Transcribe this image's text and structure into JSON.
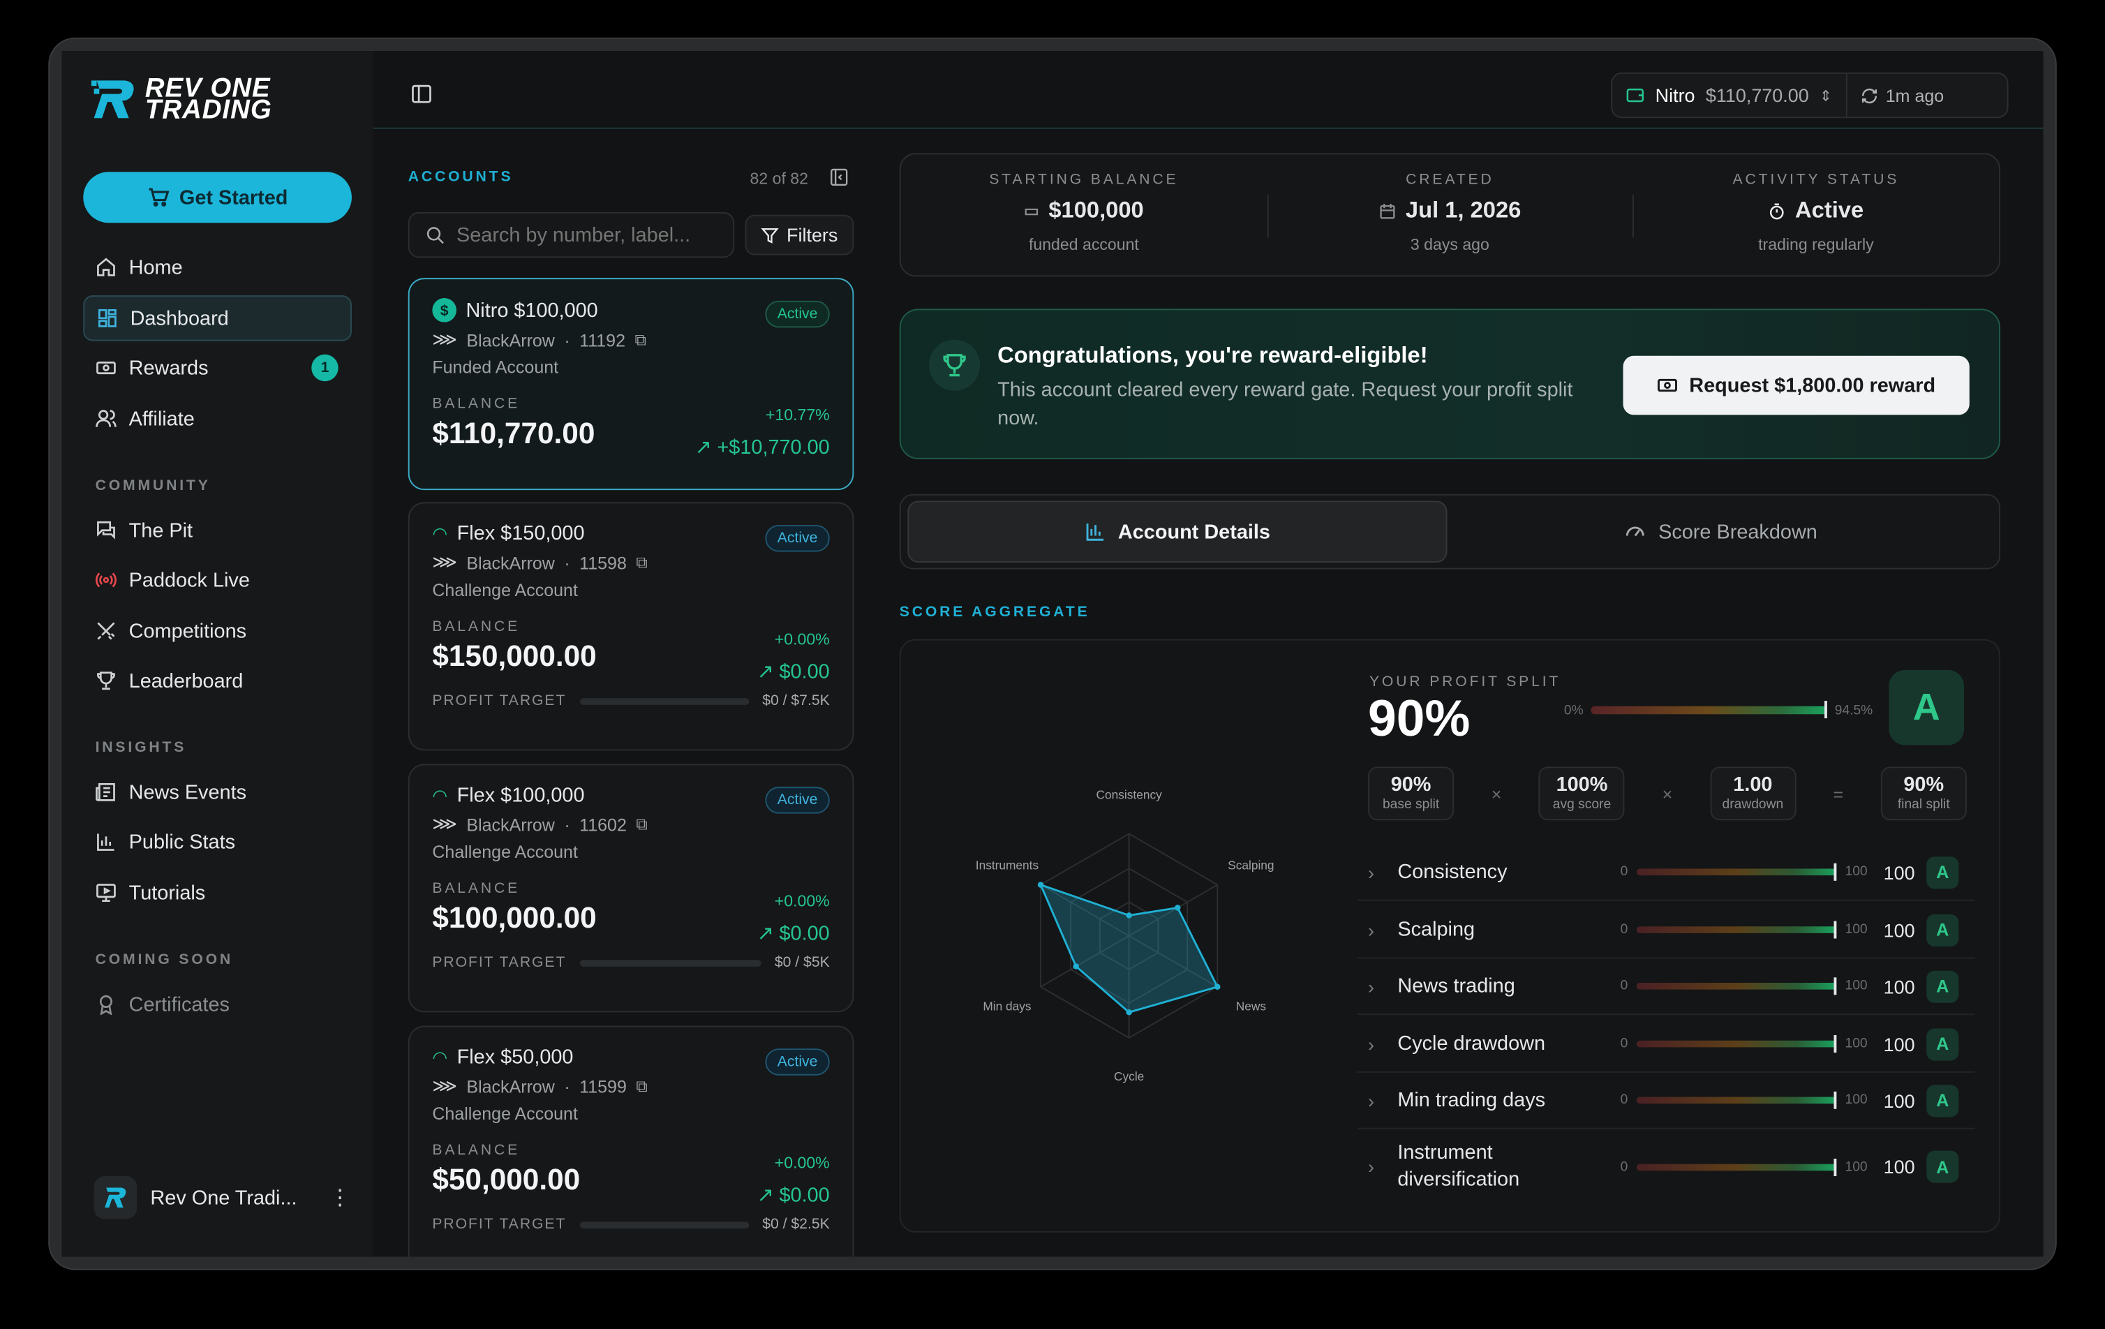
{
  "brand": {
    "name_line1": "REV ONE",
    "name_line2": "TRADING",
    "accent": "#1bb6d9"
  },
  "sidebar": {
    "cta": "Get Started",
    "nav": [
      {
        "label": "Home",
        "icon": "home-icon"
      },
      {
        "label": "Dashboard",
        "icon": "dashboard-icon",
        "active": true
      },
      {
        "label": "Rewards",
        "icon": "rewards-icon",
        "badge": "1"
      },
      {
        "label": "Affiliate",
        "icon": "users-icon"
      }
    ],
    "community_label": "COMMUNITY",
    "community": [
      {
        "label": "The Pit",
        "icon": "chat-icon"
      },
      {
        "label": "Paddock Live",
        "icon": "broadcast-icon"
      },
      {
        "label": "Competitions",
        "icon": "swords-icon"
      },
      {
        "label": "Leaderboard",
        "icon": "trophy-icon"
      }
    ],
    "insights_label": "INSIGHTS",
    "insights": [
      {
        "label": "News Events",
        "icon": "newspaper-icon"
      },
      {
        "label": "Public Stats",
        "icon": "bar-chart-icon"
      },
      {
        "label": "Tutorials",
        "icon": "monitor-icon"
      }
    ],
    "soon_label": "COMING SOON",
    "soon": [
      {
        "label": "Certificates",
        "icon": "award-icon"
      }
    ],
    "user": "Rev One Tradi..."
  },
  "topbar": {
    "account_name": "Nitro",
    "account_balance": "$110,770.00",
    "refresh": "1m ago"
  },
  "accounts": {
    "heading": "ACCOUNTS",
    "count": "82 of 82",
    "search_placeholder": "Search by number, label...",
    "filters": "Filters",
    "items": [
      {
        "name": "Nitro $100,000",
        "status": "Active",
        "provider": "BlackArrow",
        "number": "11192",
        "type": "Funded Account",
        "balance_label": "BALANCE",
        "balance": "$110,770.00",
        "pct": "+10.77%",
        "delta": "+$10,770.00"
      },
      {
        "name": "Flex $150,000",
        "status": "Active",
        "provider": "BlackArrow",
        "number": "11598",
        "type": "Challenge Account",
        "balance_label": "BALANCE",
        "balance": "$150,000.00",
        "pct": "+0.00%",
        "delta": "$0.00",
        "target_label": "PROFIT TARGET",
        "target": "$0 / $7.5K",
        "target_progress": 0
      },
      {
        "name": "Flex $100,000",
        "status": "Active",
        "provider": "BlackArrow",
        "number": "11602",
        "type": "Challenge Account",
        "balance_label": "BALANCE",
        "balance": "$100,000.00",
        "pct": "+0.00%",
        "delta": "$0.00",
        "target_label": "PROFIT TARGET",
        "target": "$0 / $5K",
        "target_progress": 0
      },
      {
        "name": "Flex $50,000",
        "status": "Active",
        "provider": "BlackArrow",
        "number": "11599",
        "type": "Challenge Account",
        "balance_label": "BALANCE",
        "balance": "$50,000.00",
        "pct": "+0.00%",
        "delta": "$0.00",
        "target_label": "PROFIT TARGET",
        "target": "$0 / $2.5K",
        "target_progress": 0
      }
    ]
  },
  "stats": [
    {
      "label": "STARTING BALANCE",
      "value": "$100,000",
      "sub": "funded account",
      "icon": "wallet-icon"
    },
    {
      "label": "CREATED",
      "value": "Jul 1, 2026",
      "sub": "3 days ago",
      "icon": "calendar-icon"
    },
    {
      "label": "ACTIVITY STATUS",
      "value": "Active",
      "sub": "trading regularly",
      "icon": "timer-icon"
    }
  ],
  "reward": {
    "title": "Congratulations, you're reward-eligible!",
    "text": "This account cleared every reward gate. Request your profit split now.",
    "button": "Request $1,800.00 reward"
  },
  "tabs": {
    "details": "Account Details",
    "breakdown": "Score Breakdown"
  },
  "score": {
    "heading": "SCORE AGGREGATE",
    "profit_split_label": "YOUR PROFIT SPLIT",
    "profit_split": "90%",
    "bar_min": "0%",
    "bar_max": "94.5%",
    "grade": "A",
    "formula": [
      {
        "v": "90%",
        "k": "base split"
      },
      {
        "op": "×"
      },
      {
        "v": "100%",
        "k": "avg score"
      },
      {
        "op": "×"
      },
      {
        "v": "1.00",
        "k": "drawdown"
      },
      {
        "op": "="
      },
      {
        "v": "90%",
        "k": "final split"
      }
    ],
    "radar": {
      "axes": [
        "Consistency",
        "Scalping",
        "News",
        "Cycle",
        "Min days",
        "Instruments"
      ],
      "values": [
        0.2,
        0.55,
        1.0,
        0.75,
        0.6,
        1.0
      ]
    },
    "metrics": [
      {
        "name": "Consistency",
        "min": "0",
        "max": "100",
        "score": "100",
        "grade": "A"
      },
      {
        "name": "Scalping",
        "min": "0",
        "max": "100",
        "score": "100",
        "grade": "A"
      },
      {
        "name": "News trading",
        "min": "0",
        "max": "100",
        "score": "100",
        "grade": "A"
      },
      {
        "name": "Cycle drawdown",
        "min": "0",
        "max": "100",
        "score": "100",
        "grade": "A"
      },
      {
        "name": "Min trading days",
        "min": "0",
        "max": "100",
        "score": "100",
        "grade": "A"
      },
      {
        "name": "Instrument diversification",
        "min": "0",
        "max": "100",
        "score": "100",
        "grade": "A"
      }
    ]
  }
}
